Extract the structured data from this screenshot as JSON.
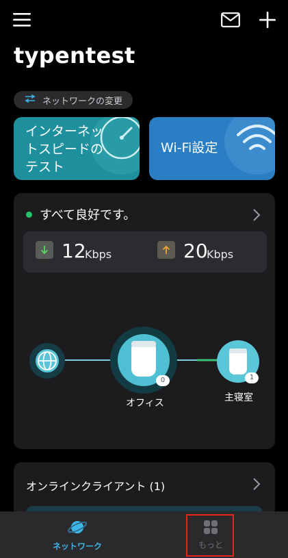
{
  "header": {
    "title": "typentest",
    "menu_icon": "hamburger-menu-icon",
    "mail_icon": "envelope-icon",
    "add_icon": "plus-icon"
  },
  "network_switch": {
    "label": "ネットワークの変更",
    "icon": "swap-arrows-icon"
  },
  "tiles": {
    "speed_test": {
      "label": "インターネットスピードのテスト",
      "icon": "speedometer-icon"
    },
    "wifi_settings": {
      "label": "Wi-Fi設定",
      "icon": "wifi-icon"
    }
  },
  "status": {
    "text": "すべて良好です。",
    "indicator_color": "#27c267",
    "download": {
      "value": "12",
      "unit": "Kbps"
    },
    "upload": {
      "value": "20",
      "unit": "Kbps"
    }
  },
  "topology": {
    "internet_icon": "globe-icon",
    "main_node": {
      "label": "オフィス",
      "clients": "0"
    },
    "satellite_node": {
      "label": "主寝室",
      "clients": "1"
    }
  },
  "clients": {
    "label": "オンラインクライアント (1)"
  },
  "bottom_nav": {
    "network": {
      "label": "ネットワーク",
      "icon": "planet-icon"
    },
    "more": {
      "label": "もっと",
      "icon": "grid-icon"
    }
  },
  "colors": {
    "accent": "#3cb4e6",
    "highlight": "#e8241c"
  }
}
